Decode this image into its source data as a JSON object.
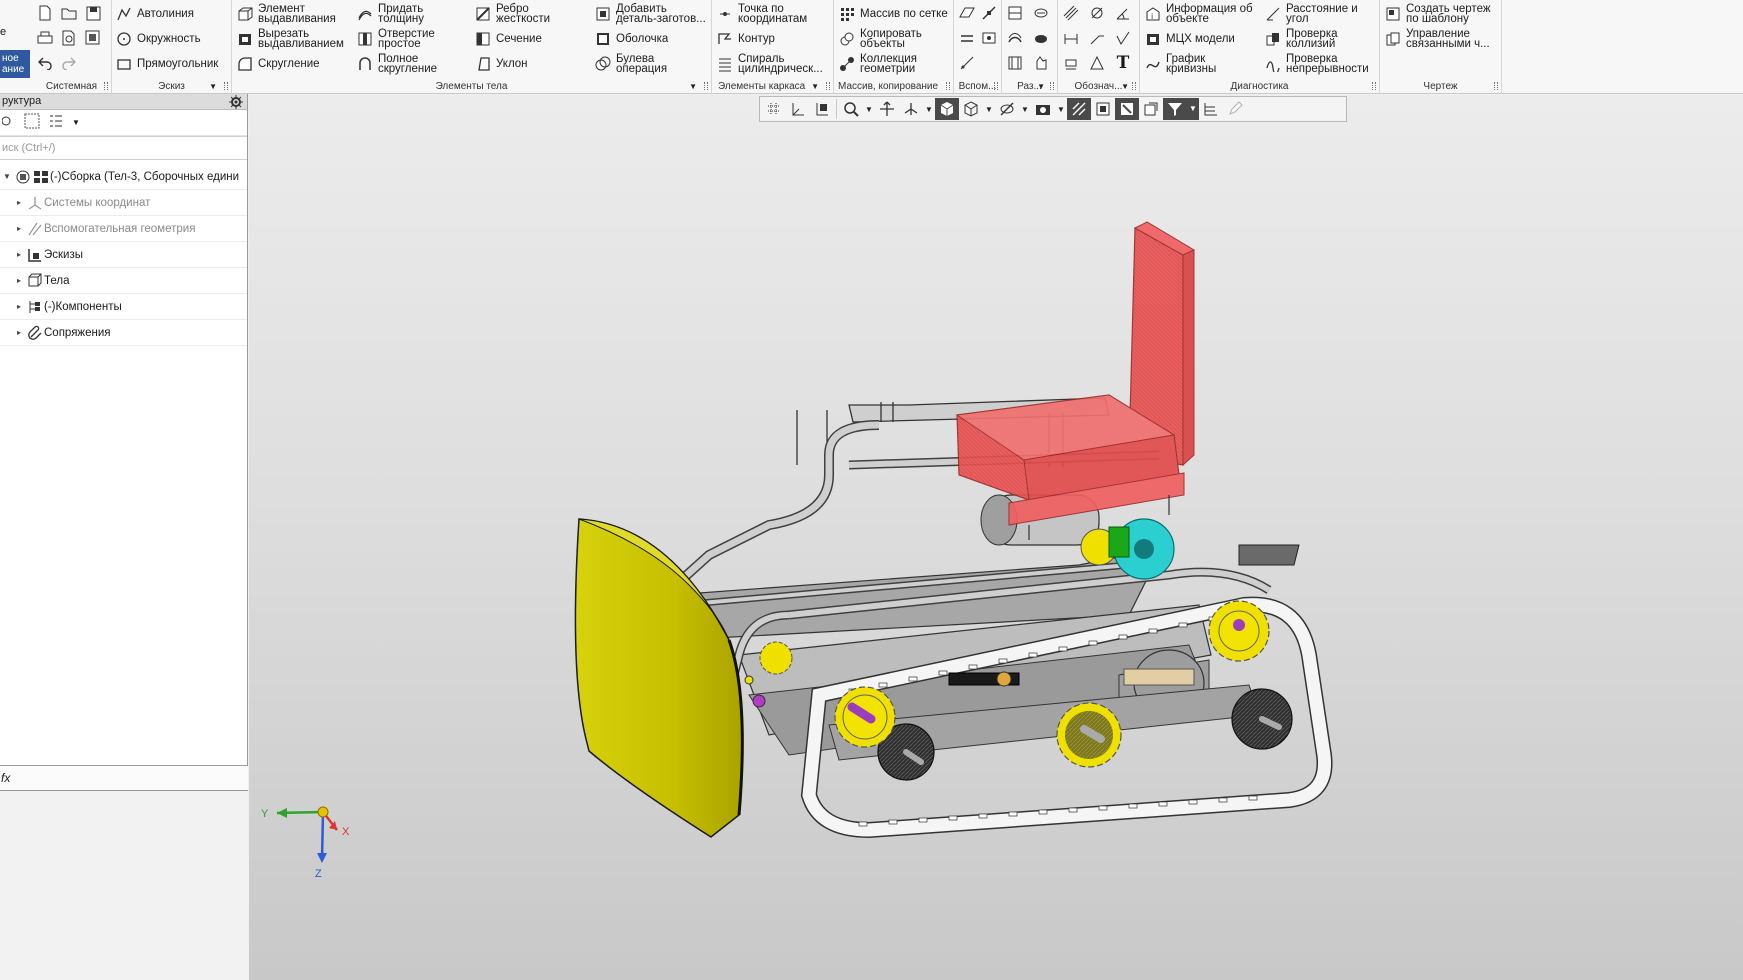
{
  "ribbon": {
    "left_button_label": "ное\nание",
    "left_top_label": "е",
    "groups": {
      "sistemnaya": "Системная",
      "eskiz": "Эскиз",
      "elementy_tela": "Элементы тела",
      "elementy_karkasa": "Элементы каркаса",
      "massiv_kopirovanie": "Массив, копирование",
      "vspom": "Вспом...",
      "raz": "Раз...",
      "oboznach": "Обознач...",
      "diagnostika": "Диагностика",
      "chertezh": "Чертеж"
    },
    "eskiz": {
      "avtoliniya": "Автолиния",
      "okruzhnost": "Окружность",
      "pryamougolnik": "Прямоугольник"
    },
    "elementy_tela": {
      "element_vydavlivaniya": [
        "Элемент",
        "выдавливания"
      ],
      "vyrezat_vydavlivaniem": [
        "Вырезать",
        "выдавливанием"
      ],
      "skruglenie": "Скругление",
      "pridat_tolshchinu": [
        "Придать",
        "толщину"
      ],
      "otverstie_prostoe": [
        "Отверстие",
        "простое"
      ],
      "polnoe_skruglenie": [
        "Полное",
        "скругление"
      ],
      "rebro_zhestkosti": [
        "Ребро",
        "жесткости"
      ],
      "sechenie": "Сечение",
      "uklon": "Уклон",
      "dobavit_detal": [
        "Добавить",
        "деталь-заготов..."
      ],
      "obolochka": "Оболочка",
      "buleva_operaciya": [
        "Булева",
        "операция"
      ]
    },
    "elementy_karkasa": {
      "tochka_po_koordinatam": [
        "Точка по",
        "координатам"
      ],
      "kontur": "Контур",
      "spiral": [
        "Спираль",
        "цилиндрическ..."
      ]
    },
    "massiv": {
      "massiv_po_setke": "Массив по сетке",
      "kopirovat_obekty": [
        "Копировать",
        "объекты"
      ],
      "kollekciya_geometrii": [
        "Коллекция",
        "геометрии"
      ]
    },
    "oboznach": {
      "text_tool": "T"
    },
    "diagnostika": {
      "informaciya_ob_obekte": [
        "Информация об",
        "объекте"
      ],
      "mcx_modeli": "МЦХ модели",
      "grafik_krivizny": [
        "График",
        "кривизны"
      ],
      "rasstoyanie_i_ugol": [
        "Расстояние и",
        "угол"
      ],
      "proverka_kollizij": [
        "Проверка",
        "коллизий"
      ],
      "proverka_nepreryvnosti": [
        "Проверка",
        "непрерывности"
      ]
    },
    "chertezh": {
      "sozdat_chertezh": [
        "Создать чертеж",
        "по шаблону"
      ],
      "upravlenie": [
        "Управление",
        "связанными ч..."
      ]
    }
  },
  "tree": {
    "header": "руктура",
    "search_placeholder": "иск (Ctrl+/)",
    "items": [
      {
        "label": "(-)Сборка (Тел-3, Сборочных едини",
        "expanded": true,
        "dim": false
      },
      {
        "label": "Системы координат",
        "expanded": false,
        "dim": true
      },
      {
        "label": "Вспомогательная геометрия",
        "expanded": false,
        "dim": true
      },
      {
        "label": "Эскизы",
        "expanded": false,
        "dim": false
      },
      {
        "label": "Тела",
        "expanded": false,
        "dim": false
      },
      {
        "label": "(-)Компоненты",
        "expanded": false,
        "dim": false
      },
      {
        "label": "Сопряжения",
        "expanded": false,
        "dim": false
      }
    ],
    "fx_label": "fx"
  },
  "viewport": {
    "axis_labels": {
      "x": "X",
      "y": "Y",
      "z": "Z"
    },
    "colors": {
      "seat": "#e84a4a",
      "blade": "#d8d20a",
      "gears_yellow": "#f0e000",
      "gear_cyan": "#2ccfcf",
      "frame": "#b7b7b7",
      "track": "#f2f2f2"
    }
  }
}
